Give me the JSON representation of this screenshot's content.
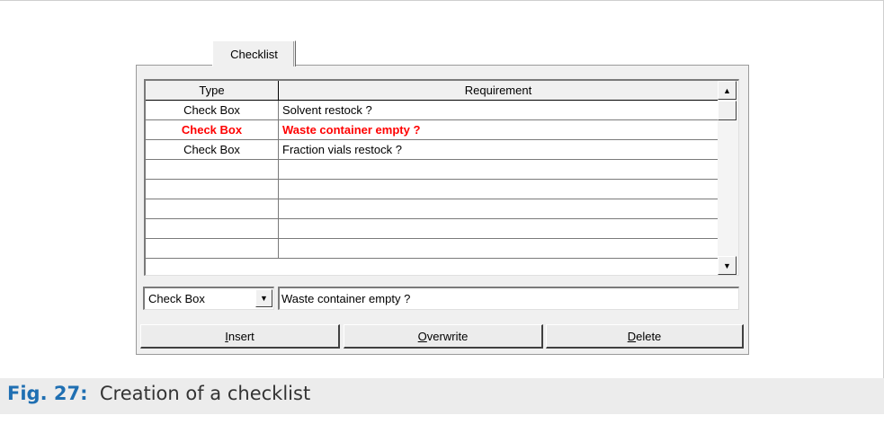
{
  "dialog": {
    "tab_label": "Checklist",
    "grid": {
      "headers": [
        "Type",
        "Requirement"
      ],
      "rows": [
        {
          "type": "Check Box",
          "requirement": "Solvent restock ?"
        },
        {
          "type": "Check Box",
          "requirement": "Waste container empty ?"
        },
        {
          "type": "Check Box",
          "requirement": "Fraction vials restock ?"
        },
        {
          "type": "",
          "requirement": ""
        },
        {
          "type": "",
          "requirement": ""
        },
        {
          "type": "",
          "requirement": ""
        },
        {
          "type": "",
          "requirement": ""
        },
        {
          "type": "",
          "requirement": ""
        }
      ],
      "selected_row_index": 1,
      "selected_color": "#ff0000"
    },
    "editor": {
      "type_value": "Check Box",
      "requirement_value": "Waste container empty ?"
    },
    "buttons": {
      "insert_mnemonic": "I",
      "insert_rest": "nsert",
      "overwrite_mnemonic": "O",
      "overwrite_rest": "verwrite",
      "delete_mnemonic": "D",
      "delete_rest": "elete"
    }
  },
  "caption": {
    "label": "Fig. 27:",
    "text": "Creation of a checklist",
    "label_color": "#1f6fb2"
  }
}
